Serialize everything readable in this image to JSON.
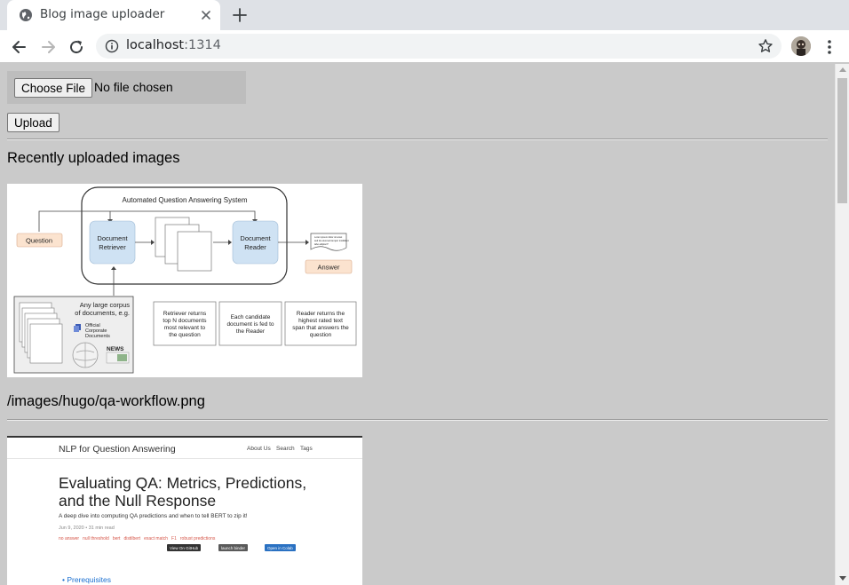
{
  "browser": {
    "tab_title": "Blog image uploader",
    "url_host": "localhost",
    "url_port": ":1314"
  },
  "uploader": {
    "choose_label": "Choose File",
    "file_status": "No file chosen",
    "upload_label": "Upload"
  },
  "recent": {
    "heading": "Recently uploaded images",
    "items": [
      {
        "path": "/images/hugo/qa-workflow.png",
        "diagram": {
          "title": "Automated Question Answering System",
          "question": "Question",
          "retriever_line1": "Document",
          "retriever_line2": "Retriever",
          "reader_line1": "Document",
          "reader_line2": "Reader",
          "answer": "Answer",
          "lorem_line1": "Lorem ipsum dolor sit amet",
          "lorem_line2": "sed do eiusmod tempor incididunt",
          "lorem_line3": "labo adipisci?",
          "corpus_line1": "Any large corpus",
          "corpus_line2": "of documents, e.g.",
          "official_line1": "Official",
          "official_line2": "Corporate",
          "official_line3": "Documents",
          "news": "NEWS",
          "note1_line1": "Retriever returns",
          "note1_line2": "top N documents",
          "note1_line3": "most relevant to",
          "note1_line4": "the question",
          "note2_line1": "Each candidate",
          "note2_line2": "document is fed to",
          "note2_line3": "the Reader",
          "note3_line1": "Reader returns the",
          "note3_line2": "highest rated text",
          "note3_line3": "span that answers the",
          "note3_line4": "question"
        }
      },
      {
        "blog": {
          "brand": "NLP for Question Answering",
          "nav_about": "About Us",
          "nav_search": "Search",
          "nav_tags": "Tags",
          "title": "Evaluating QA: Metrics, Predictions, and the Null Response",
          "subtitle": "A deep dive into computing QA predictions and when to tell BERT to zip it!",
          "meta": "Jun 9, 2020 • 31 min read",
          "tags": [
            "no answer",
            "null threshold",
            "bert",
            "distilbert",
            "exact match",
            "F1",
            "robust predictions"
          ],
          "badge_github": "View On GitHub",
          "badge_binder": "launch binder",
          "badge_colab": "Open in Colab",
          "toc_first": "Prerequisites"
        }
      }
    ]
  },
  "colors": {
    "page_bg": "#cacaca",
    "file_box_bg": "#bdbdbd",
    "peach": "#fbe3cf",
    "blue_box": "#cfe2f3",
    "link": "#1a6fd0"
  }
}
